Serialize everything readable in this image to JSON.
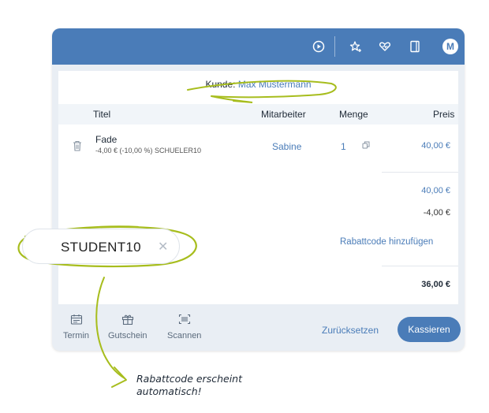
{
  "customer": {
    "label": "Kunde:",
    "name": "Max Mustermann"
  },
  "table": {
    "headers": {
      "title": "Titel",
      "staff": "Mitarbeiter",
      "qty": "Menge",
      "price": "Preis"
    }
  },
  "item": {
    "title": "Fade",
    "discount": "-4,00 € (-10,00 %) SCHUELER10",
    "staff": "Sabine",
    "qty": "1",
    "price": "40,00 €"
  },
  "totals": {
    "subtotal": "40,00 €",
    "discount": "-4,00 €",
    "add_coupon": "Rabattcode hinzufügen",
    "total": "36,00 €"
  },
  "bottom": {
    "nav": [
      "Termin",
      "Gutschein",
      "Scannen"
    ],
    "reset": "Zurücksetzen",
    "pay": "Kassieren"
  },
  "topbar": {
    "avatar_letter": "M",
    "icons": [
      "play-circle-icon",
      "star-sparkle-icon",
      "heart-icon",
      "document-icon"
    ]
  },
  "coupon": {
    "code": "STUDENT10"
  },
  "annotation": {
    "line1": "Rabattcode erscheint",
    "line2": "automatisch!"
  },
  "colors": {
    "brand": "#4a7cb8",
    "highlight": "#a7bd1d"
  }
}
